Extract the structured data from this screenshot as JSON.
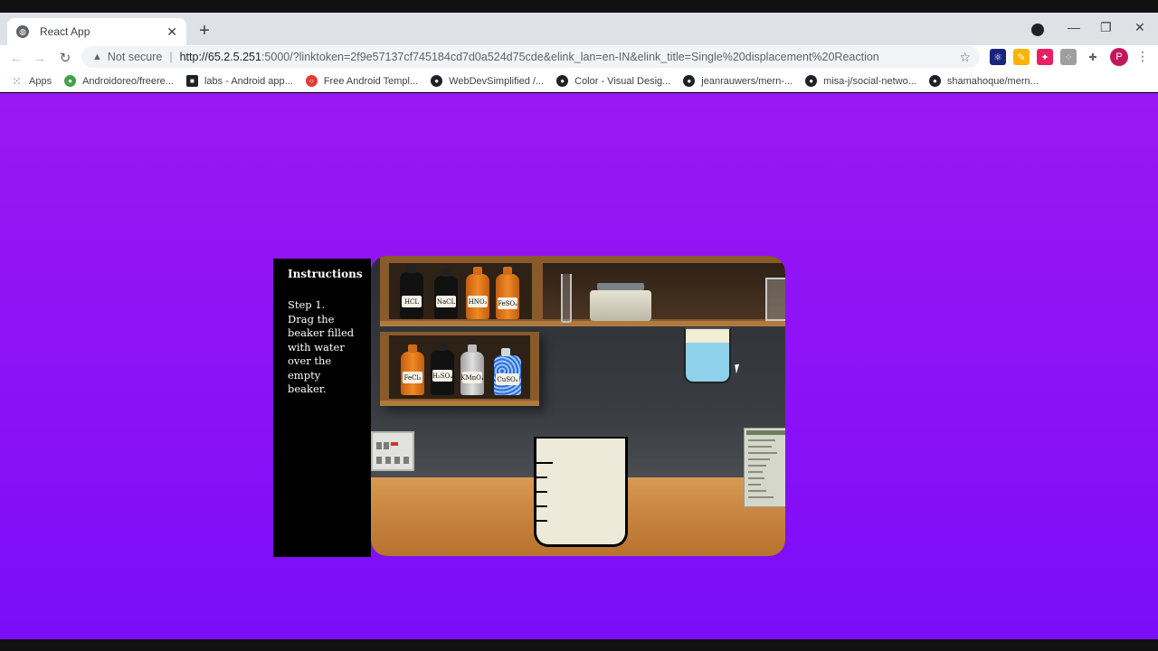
{
  "browser": {
    "tab_title": "React App",
    "tab_close": "✕",
    "new_tab": "+",
    "security_label": "Not secure",
    "url_host": "http://65.2.5.251",
    "url_rest": ":5000/?linktoken=2f9e57137cf745184cd7d0a524d75cde&elink_lan=en-IN&elink_title=Single%20displacement%20Reaction",
    "profile_initial": "P",
    "window_controls": [
      "—",
      "❐",
      "✕"
    ]
  },
  "bookmarks": [
    {
      "label": "Apps",
      "icon": "apps-grid-icon"
    },
    {
      "label": "Androidoreo/freere...",
      "icon": "android-icon"
    },
    {
      "label": "labs - Android app...",
      "icon": "labs-icon"
    },
    {
      "label": "Free Android Templ...",
      "icon": "template-icon"
    },
    {
      "label": "WebDevSimplified /...",
      "icon": "github-icon"
    },
    {
      "label": "Color - Visual Desig...",
      "icon": "apple-icon"
    },
    {
      "label": "jeanrauwers/mern-...",
      "icon": "github-icon"
    },
    {
      "label": "misa-j/social-netwo...",
      "icon": "github-icon"
    },
    {
      "label": "shamahoque/mern...",
      "icon": "github-icon"
    }
  ],
  "instructions": {
    "heading": "Instructions",
    "step": "Step 1.",
    "text": "Drag the beaker filled with water over the empty beaker."
  },
  "lab": {
    "top_shelf_bottles": [
      {
        "label": "HCL",
        "color": "#111111"
      },
      {
        "label": "NaCL",
        "color": "#111111"
      },
      {
        "label": "HNO₃",
        "color": "#e67e22"
      },
      {
        "label": "FeSO₄",
        "color": "#e67e22"
      }
    ],
    "bottom_shelf_bottles": [
      {
        "label": "FeCl₃",
        "color": "#e67e22"
      },
      {
        "label": "H₂SO₄",
        "color": "#111111"
      },
      {
        "label": "KMnO₄",
        "color": "#bdbdbd"
      },
      {
        "label": "CuSO₄",
        "color": "#2b6fd6"
      }
    ]
  },
  "colors": {
    "background_top": "#9a18f2",
    "background_bottom": "#7a0ef8",
    "water": "#8fd0ea"
  }
}
